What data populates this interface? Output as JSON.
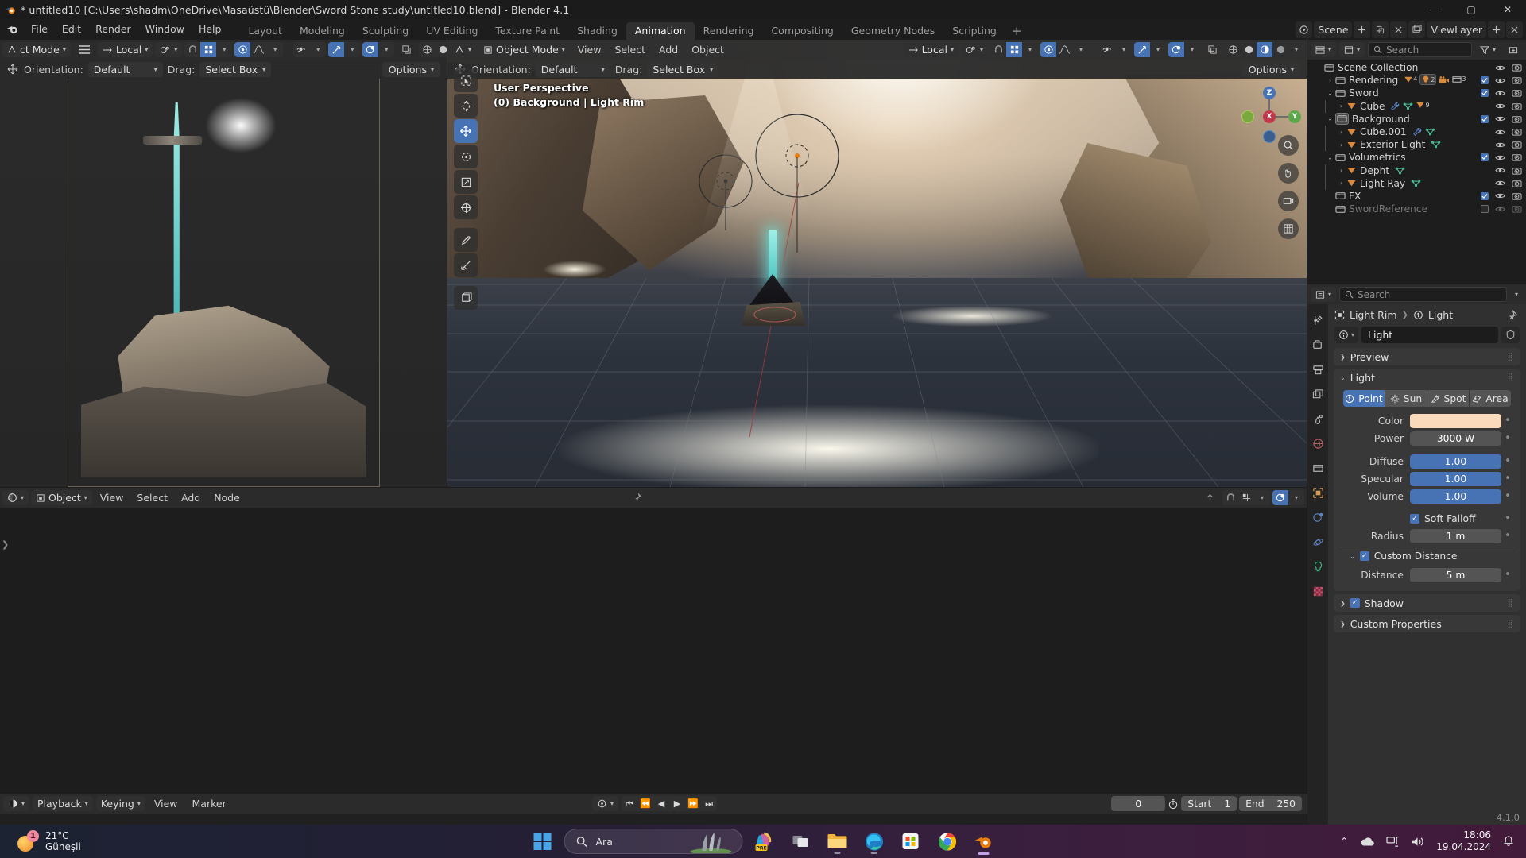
{
  "window": {
    "title": "* untitled10 [C:\\Users\\shadm\\OneDrive\\Masaüstü\\Blender\\Sword Stone study\\untitled10.blend] - Blender 4.1",
    "minimize": "—",
    "maximize": "▢",
    "close": "✕"
  },
  "menu": {
    "items": [
      "File",
      "Edit",
      "Render",
      "Window",
      "Help"
    ]
  },
  "workspaces": {
    "tabs": [
      "Layout",
      "Modeling",
      "Sculpting",
      "UV Editing",
      "Texture Paint",
      "Shading",
      "Animation",
      "Rendering",
      "Compositing",
      "Geometry Nodes",
      "Scripting"
    ],
    "active": "Animation",
    "add_label": "+"
  },
  "topbar_right": {
    "scene_name": "Scene",
    "viewlayer_name": "ViewLayer"
  },
  "viewport_left": {
    "header": {
      "mode": "ct Mode",
      "transform_orientation": "Local",
      "orientation_label": "Orientation:",
      "orientation_value": "Default",
      "drag_label": "Drag:",
      "drag_value": "Select Box",
      "options": "Options"
    }
  },
  "viewport_right": {
    "header": {
      "mode": "Object Mode",
      "menus": [
        "View",
        "Select",
        "Add",
        "Object"
      ],
      "transform_orientation": "Local",
      "orientation_label": "Orientation:",
      "orientation_value": "Default",
      "drag_label": "Drag:",
      "drag_value": "Select Box",
      "options": "Options"
    },
    "overlay": {
      "perspective": "User Perspective",
      "collection_object": "(0) Background | Light Rim"
    },
    "gizmo_axes": [
      "Z",
      "X",
      "Y"
    ]
  },
  "toolbar": {
    "tools": [
      "tweak-select-icon",
      "cursor-icon",
      "move-icon",
      "rotate-icon",
      "scale-icon",
      "transform-icon",
      "annotate-icon",
      "measure-icon",
      "add-cube-icon"
    ],
    "active_index": 2
  },
  "outliner": {
    "search_placeholder": "Search",
    "rows": [
      {
        "name": "Scene Collection",
        "indent": 0,
        "icon": "collection-icon",
        "disclosure": "",
        "checkbox": null,
        "eye": false,
        "camera": false,
        "badges": []
      },
      {
        "name": "Rendering",
        "indent": 1,
        "icon": "collection-icon",
        "disclosure": "›",
        "checkbox": true,
        "eye": true,
        "camera": true,
        "badges": [
          "mesh-4",
          "light-2",
          "camera",
          "collection-3"
        ]
      },
      {
        "name": "Sword",
        "indent": 1,
        "icon": "collection-icon",
        "disclosure": "⌄",
        "checkbox": true,
        "eye": true,
        "camera": true,
        "badges": []
      },
      {
        "name": "Cube",
        "indent": 2,
        "icon": "object-mesh-icon",
        "disclosure": "›",
        "checkbox": null,
        "eye": true,
        "camera": true,
        "badges": [
          "modifier",
          "mesh-data",
          "material-9"
        ]
      },
      {
        "name": "Background",
        "indent": 1,
        "icon": "collection-icon",
        "disclosure": "⌄",
        "checkbox": true,
        "eye": true,
        "camera": true,
        "badges": [],
        "highlighted": true
      },
      {
        "name": "Cube.001",
        "indent": 2,
        "icon": "object-mesh-icon",
        "disclosure": "›",
        "checkbox": null,
        "eye": true,
        "camera": true,
        "badges": [
          "modifier",
          "mesh-data"
        ]
      },
      {
        "name": "Exterior Light",
        "indent": 2,
        "icon": "object-mesh-icon",
        "disclosure": "›",
        "checkbox": null,
        "eye": true,
        "camera": true,
        "badges": [
          "mesh-data"
        ]
      },
      {
        "name": "Volumetrics",
        "indent": 1,
        "icon": "collection-icon",
        "disclosure": "⌄",
        "checkbox": true,
        "eye": true,
        "camera": true,
        "badges": []
      },
      {
        "name": "Depht",
        "indent": 2,
        "icon": "object-mesh-icon",
        "disclosure": "›",
        "checkbox": null,
        "eye": true,
        "camera": true,
        "badges": [
          "mesh-data"
        ]
      },
      {
        "name": "Light Ray",
        "indent": 2,
        "icon": "object-mesh-icon",
        "disclosure": "›",
        "checkbox": null,
        "eye": true,
        "camera": true,
        "badges": [
          "mesh-data"
        ]
      },
      {
        "name": "FX",
        "indent": 1,
        "icon": "collection-icon",
        "disclosure": "",
        "checkbox": true,
        "eye": true,
        "camera": true,
        "badges": []
      },
      {
        "name": "SwordReference",
        "indent": 1,
        "icon": "collection-icon",
        "disclosure": "",
        "checkbox": false,
        "eye": true,
        "camera": true,
        "badges": [],
        "dim": true
      }
    ]
  },
  "properties": {
    "search_placeholder": "Search",
    "breadcrumb": {
      "object": "Light Rim",
      "data": "Light"
    },
    "id_name": "Light",
    "tabs": [
      "tool-icon",
      "render-icon",
      "output-icon",
      "viewlayer-icon",
      "scene-icon",
      "world-icon",
      "collection-icon",
      "object-icon",
      "modifiers-icon",
      "physics-icon",
      "data-light-icon",
      "material-icon"
    ],
    "active_tab_index": 10,
    "panels": [
      {
        "title": "Preview",
        "expanded": false
      },
      {
        "title": "Light",
        "expanded": true
      }
    ],
    "light": {
      "types": [
        "Point",
        "Sun",
        "Spot",
        "Area"
      ],
      "active_type": "Point",
      "fields": [
        {
          "label": "Color",
          "value": "",
          "kind": "color",
          "color": "#fbd9bb"
        },
        {
          "label": "Power",
          "value": "3000 W",
          "kind": "text"
        },
        {
          "label": "Diffuse",
          "value": "1.00",
          "kind": "slider"
        },
        {
          "label": "Specular",
          "value": "1.00",
          "kind": "slider"
        },
        {
          "label": "Volume",
          "value": "1.00",
          "kind": "slider"
        }
      ],
      "soft_falloff": {
        "label": "Soft Falloff",
        "checked": true
      },
      "radius": {
        "label": "Radius",
        "value": "1 m"
      },
      "custom_distance": {
        "label": "Custom Distance",
        "checked": true
      },
      "distance": {
        "label": "Distance",
        "value": "5 m"
      }
    },
    "shadow": {
      "label": "Shadow",
      "checked": true
    },
    "custom_properties": {
      "label": "Custom Properties"
    }
  },
  "node_editor": {
    "header": {
      "editor_type": "compositor-icon",
      "context": "Object",
      "menus": [
        "View",
        "Select",
        "Add",
        "Node"
      ]
    }
  },
  "timeline": {
    "header": {
      "editor_type": "timeline-icon",
      "playback": "Playback",
      "keying": "Keying",
      "menus": [
        "View",
        "Marker"
      ],
      "current_frame": "0",
      "start_label": "Start",
      "start_value": "1",
      "end_label": "End",
      "end_value": "250"
    }
  },
  "status": {
    "version": "4.1.0"
  },
  "taskbar": {
    "weather": {
      "temperature": "21°C",
      "condition": "Güneşli",
      "badge": "1"
    },
    "search_placeholder": "Ara",
    "apps": [
      "windows-start-icon",
      "copilot-icon",
      "task-view-icon",
      "file-explorer-icon",
      "edge-icon",
      "microsoft-store-icon",
      "chrome-icon",
      "blender-icon"
    ],
    "tray": {
      "chevron": "⌃",
      "onedrive": "onedrive-icon",
      "network": "network-icon",
      "volume": "volume-icon",
      "notification": "bell-icon"
    },
    "clock": {
      "time": "18:06",
      "date": "19.04.2024"
    }
  }
}
